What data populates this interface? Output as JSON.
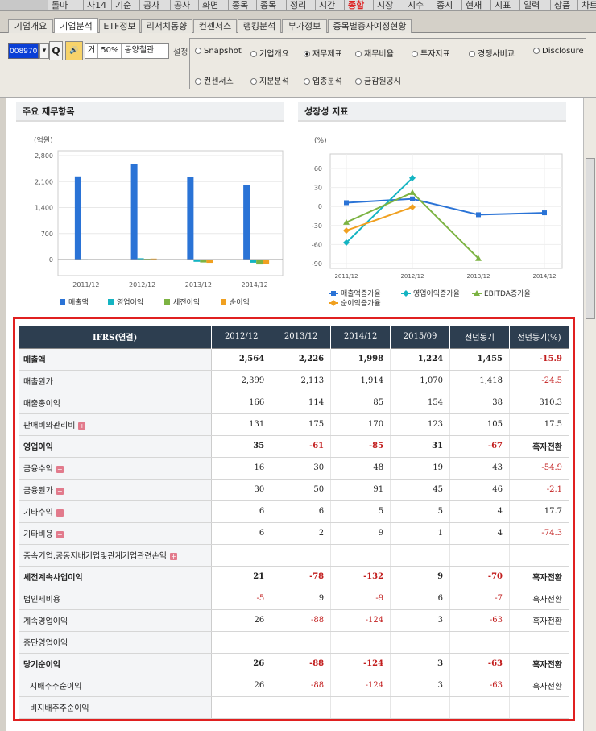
{
  "topbar": {
    "items": [
      "돌마",
      "사14",
      "기순",
      "공사",
      "공사",
      "화면",
      "종목",
      "종목",
      "정리",
      "시간",
      "종합",
      "시장",
      "시수",
      "종시",
      "현재",
      "시표",
      "일력",
      "상품",
      "차트"
    ],
    "active_index": 10
  },
  "tabs": [
    "기업개요",
    "기업분석",
    "ETF정보",
    "리서치동향",
    "컨센서스",
    "랭킹분석",
    "부가정보",
    "종목별증자예정현황"
  ],
  "active_tab": 1,
  "toolbar": {
    "code_value": "008970",
    "search_label": "Q",
    "speaker_label": "🔊",
    "type_label": "거",
    "margin_label": "50%",
    "company_name": "동양철관",
    "settings_label": "설정"
  },
  "radios": [
    "Snapshot",
    "기업개요",
    "재무제표",
    "재무비율",
    "투자지표",
    "경쟁사비교",
    "Disclosure",
    "컨센서스",
    "지분분석",
    "업종분석",
    "금감원공시"
  ],
  "radio_selected": 2,
  "left_panel": {
    "title": "주요 재무항목"
  },
  "right_panel": {
    "title": "성장성 지표"
  },
  "chart_data": [
    {
      "type": "bar",
      "ylabel": "(억원)",
      "categories": [
        "2011/12",
        "2012/12",
        "2013/12",
        "2014/12"
      ],
      "yticks": [
        "2,800",
        "2,100",
        "1,400",
        "700",
        "0"
      ],
      "ylim": [
        -200,
        2800
      ],
      "series": [
        {
          "name": "매출액",
          "color": "#2a73d6",
          "values": [
            2240,
            2564,
            2226,
            1998
          ]
        },
        {
          "name": "영업이익",
          "color": "#14b4c2",
          "values": [
            12,
            35,
            -61,
            -85
          ]
        },
        {
          "name": "세전이익",
          "color": "#7cb342",
          "values": [
            5,
            21,
            -78,
            -132
          ]
        },
        {
          "name": "순이익",
          "color": "#f0a020",
          "values": [
            3,
            26,
            -88,
            -124
          ]
        }
      ]
    },
    {
      "type": "line",
      "ylabel": "(%)",
      "categories": [
        "2011/12",
        "2012/12",
        "2013/12",
        "2014/12"
      ],
      "yticks": [
        "60",
        "30",
        "0",
        "-30",
        "-60",
        "-90"
      ],
      "ylim": [
        -90,
        60
      ],
      "series": [
        {
          "name": "매출액증가율",
          "color": "#2a73d6",
          "marker": "square",
          "values": [
            6,
            12,
            -13,
            -10
          ]
        },
        {
          "name": "영업이익증가율",
          "color": "#14b4c2",
          "marker": "diamond",
          "values": [
            -57,
            45,
            null,
            null
          ]
        },
        {
          "name": "EBITDA증가율",
          "color": "#7cb342",
          "marker": "triangle",
          "values": [
            -25,
            22,
            -82,
            null
          ]
        },
        {
          "name": "순이익증가율",
          "color": "#f0a020",
          "marker": "diamond",
          "values": [
            -38,
            -1,
            null,
            null
          ]
        }
      ]
    }
  ],
  "table": {
    "headers": [
      "IFRS(연결)",
      "2012/12",
      "2013/12",
      "2014/12",
      "2015/09",
      "전년동기",
      "전년동기(%)"
    ],
    "rows": [
      {
        "label": "매출액",
        "bold": true,
        "plus": false,
        "indent": false,
        "cells": [
          "2,564",
          "2,226",
          "1,998",
          "1,224",
          "1,455",
          "-15.9"
        ]
      },
      {
        "label": "매출원가",
        "bold": false,
        "plus": false,
        "indent": false,
        "cells": [
          "2,399",
          "2,113",
          "1,914",
          "1,070",
          "1,418",
          "-24.5"
        ]
      },
      {
        "label": "매출총이익",
        "bold": false,
        "plus": false,
        "indent": false,
        "cells": [
          "166",
          "114",
          "85",
          "154",
          "38",
          "310.3"
        ]
      },
      {
        "label": "판매비와관리비",
        "bold": false,
        "plus": true,
        "indent": false,
        "cells": [
          "131",
          "175",
          "170",
          "123",
          "105",
          "17.5"
        ]
      },
      {
        "label": "영업이익",
        "bold": true,
        "plus": false,
        "indent": false,
        "cells": [
          "35",
          "-61",
          "-85",
          "31",
          "-67",
          "흑자전환"
        ]
      },
      {
        "label": "금융수익",
        "bold": false,
        "plus": true,
        "indent": false,
        "cells": [
          "16",
          "30",
          "48",
          "19",
          "43",
          "-54.9"
        ]
      },
      {
        "label": "금융원가",
        "bold": false,
        "plus": true,
        "indent": false,
        "cells": [
          "30",
          "50",
          "91",
          "45",
          "46",
          "-2.1"
        ]
      },
      {
        "label": "기타수익",
        "bold": false,
        "plus": true,
        "indent": false,
        "cells": [
          "6",
          "6",
          "5",
          "5",
          "4",
          "17.7"
        ]
      },
      {
        "label": "기타비용",
        "bold": false,
        "plus": true,
        "indent": false,
        "cells": [
          "6",
          "2",
          "9",
          "1",
          "4",
          "-74.3"
        ]
      },
      {
        "label": "종속기업,공동지배기업및관계기업관련손익",
        "bold": false,
        "plus": true,
        "indent": false,
        "cells": [
          "",
          "",
          "",
          "",
          "",
          ""
        ]
      },
      {
        "label": "세전계속사업이익",
        "bold": true,
        "plus": false,
        "indent": false,
        "cells": [
          "21",
          "-78",
          "-132",
          "9",
          "-70",
          "흑자전환"
        ]
      },
      {
        "label": "법인세비용",
        "bold": false,
        "plus": false,
        "indent": false,
        "cells": [
          "-5",
          "9",
          "-9",
          "6",
          "-7",
          "흑자전환"
        ]
      },
      {
        "label": "계속영업이익",
        "bold": false,
        "plus": false,
        "indent": false,
        "cells": [
          "26",
          "-88",
          "-124",
          "3",
          "-63",
          "흑자전환"
        ]
      },
      {
        "label": "중단영업이익",
        "bold": false,
        "plus": false,
        "indent": false,
        "cells": [
          "",
          "",
          "",
          "",
          "",
          ""
        ]
      },
      {
        "label": "당기순이익",
        "bold": true,
        "plus": false,
        "indent": false,
        "cells": [
          "26",
          "-88",
          "-124",
          "3",
          "-63",
          "흑자전환"
        ]
      },
      {
        "label": "지배주주순이익",
        "bold": false,
        "plus": false,
        "indent": true,
        "cells": [
          "26",
          "-88",
          "-124",
          "3",
          "-63",
          "흑자전환"
        ]
      },
      {
        "label": "비지배주주순이익",
        "bold": false,
        "plus": false,
        "indent": true,
        "cells": [
          "",
          "",
          "",
          "",
          "",
          ""
        ]
      }
    ]
  }
}
